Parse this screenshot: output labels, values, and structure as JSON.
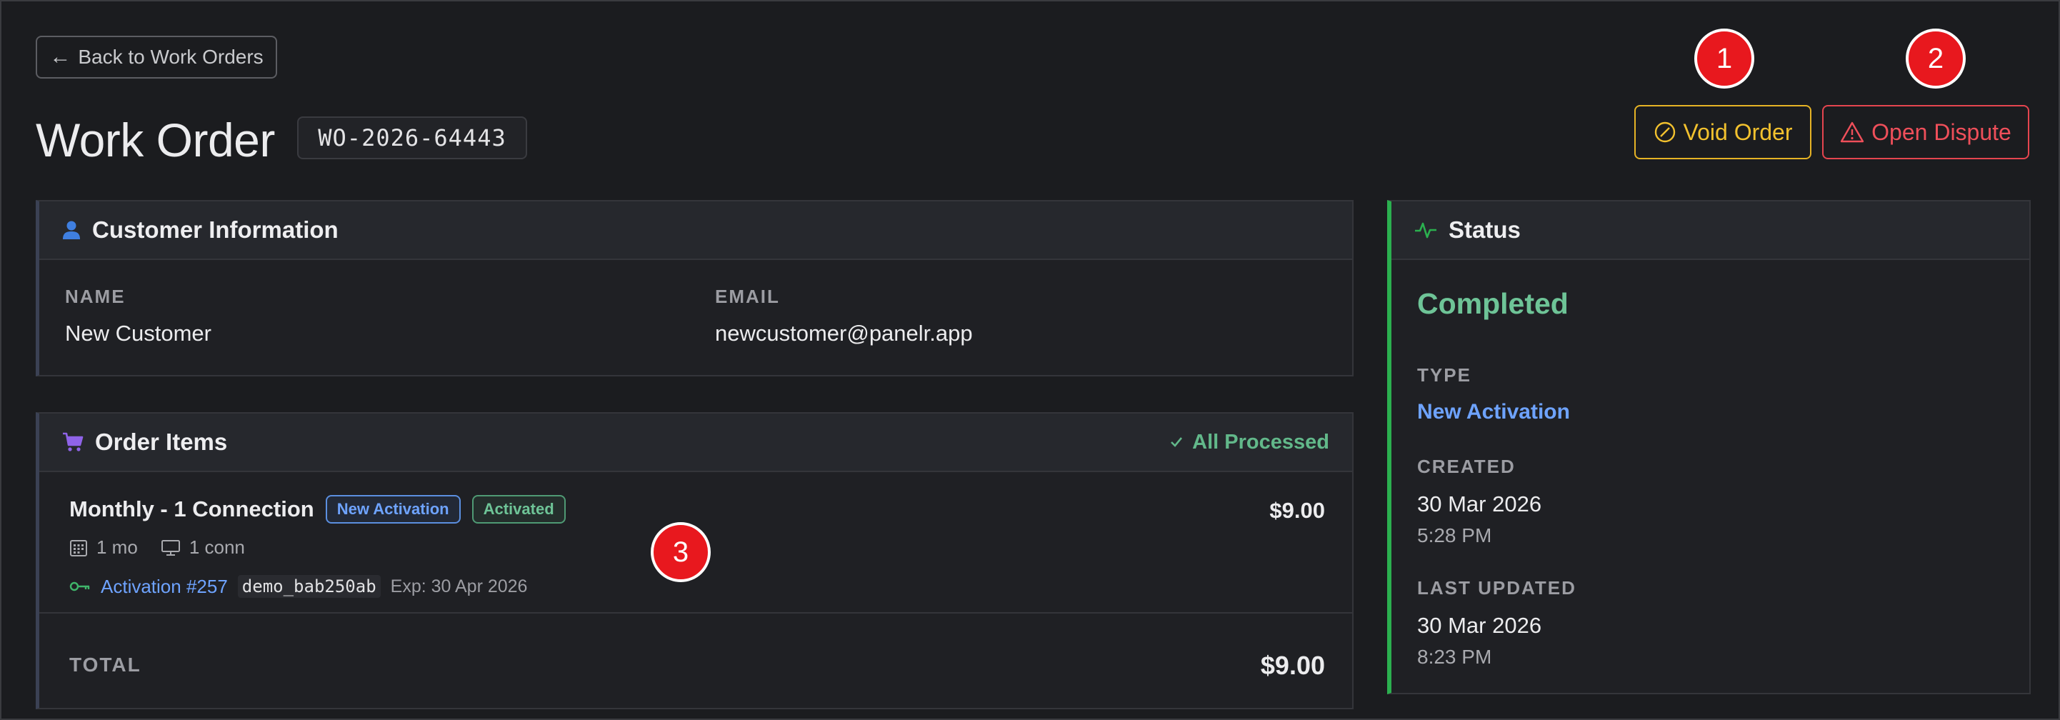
{
  "nav": {
    "back_label": "Back to Work Orders"
  },
  "header": {
    "title": "Work Order",
    "order_id": "WO-2026-64443",
    "void_label": "Void Order",
    "dispute_label": "Open Dispute"
  },
  "callouts": [
    "1",
    "2",
    "3"
  ],
  "customer": {
    "title": "Customer Information",
    "name_label": "NAME",
    "name_value": "New Customer",
    "email_label": "EMAIL",
    "email_value": "newcustomer@panelr.app"
  },
  "items": {
    "title": "Order Items",
    "status": "All Processed",
    "line": {
      "name": "Monthly - 1 Connection",
      "badge_type": "New Activation",
      "badge_state": "Activated",
      "price": "$9.00",
      "duration": "1 mo",
      "connections": "1 conn",
      "activation_link": "Activation #257",
      "username": "demo_bab250ab",
      "expiry": "Exp: 30 Apr 2026"
    },
    "total_label": "TOTAL",
    "total_value": "$9.00"
  },
  "status": {
    "title": "Status",
    "value": "Completed",
    "type_label": "TYPE",
    "type_value": "New Activation",
    "created_label": "CREATED",
    "created_date": "30 Mar 2026",
    "created_time": "5:28 PM",
    "updated_label": "LAST UPDATED",
    "updated_date": "30 Mar 2026",
    "updated_time": "8:23 PM"
  },
  "colors": {
    "background": "#1b1c1f",
    "void": "#f2c12e",
    "dispute": "#ef4f5a",
    "completed": "#6ec497",
    "link": "#6ea3ff",
    "status_accent": "#2bb04f",
    "cart_icon": "#8f63e8",
    "person_icon": "#3f7fe0"
  }
}
